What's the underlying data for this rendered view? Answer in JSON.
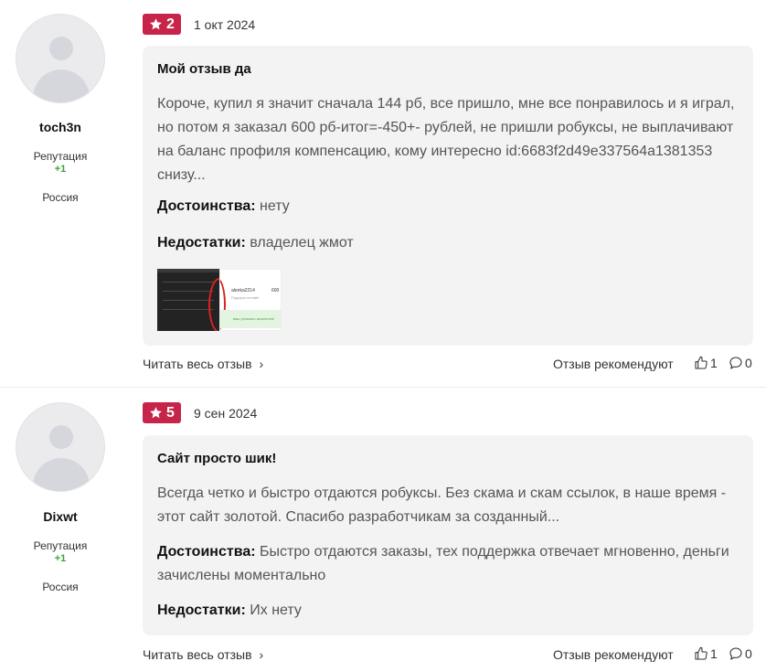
{
  "reviews": [
    {
      "username": "toch3n",
      "reputation_label": "Репутация",
      "reputation_value": "+1",
      "country": "Россия",
      "rating": "2",
      "date": "1 окт 2024",
      "title": "Мой отзыв да",
      "body": "Короче, купил я значит сначала 144 рб, все пришло, мне все понравилось и я играл, но потом я заказал 600 рб-итог=-450+- рублей, не пришли робуксы, не выплачивают на баланс профиля компенсацию, кому интересно id:6683f2d49e337564a1381353 снизу...",
      "pros_label": "Достоинства:",
      "pros": "нету",
      "cons_label": "Недостатки:",
      "cons": "владелец жмот",
      "read_more": "Читать весь отзыв",
      "recommend_label": "Отзыв рекомендуют",
      "likes": "1",
      "comments": "0",
      "thumb_text_1": "alenka2214",
      "thumb_text_2": "600",
      "thumb_text_3": "Подарок онлайн",
      "thumb_text_4": "ваш успешно выполнен!"
    },
    {
      "username": "Dixwt",
      "reputation_label": "Репутация",
      "reputation_value": "+1",
      "country": "Россия",
      "rating": "5",
      "date": "9 сен 2024",
      "title": "Сайт просто шик!",
      "body": "Всегда четко и быстро отдаются робуксы. Без скама и скам ссылок, в наше время - этот сайт золотой. Спасибо разработчикам за созданный...",
      "pros_label": "Достоинства:",
      "pros": "Быстро отдаются заказы, тех поддержка отвечает мгновенно, деньги зачислены моментально",
      "cons_label": "Недостатки:",
      "cons": "Их нету",
      "read_more": "Читать весь отзыв",
      "recommend_label": "Отзыв рекомендуют",
      "likes": "1",
      "comments": "0"
    }
  ],
  "colors": {
    "rating_badge": "#c7244a",
    "reputation": "#3aa335",
    "card_bg": "#f3f3f4"
  },
  "icons": [
    "star-icon",
    "chevron-right-icon",
    "thumbs-up-icon",
    "comment-icon",
    "user-avatar-placeholder"
  ]
}
